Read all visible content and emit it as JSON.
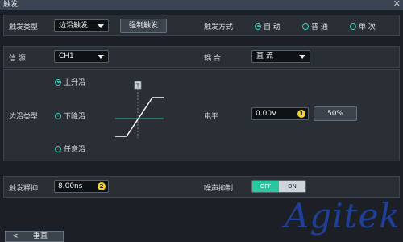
{
  "window": {
    "title": "触发",
    "close_icon": "close-icon"
  },
  "trigger_type": {
    "label": "触发类型",
    "value": "边沿触发",
    "force_button": "强制触发"
  },
  "trigger_mode": {
    "label": "触发方式",
    "options": [
      "自 动",
      "普 通",
      "单 次"
    ],
    "selected_index": 0
  },
  "source": {
    "label": "信 源",
    "value": "CH1"
  },
  "coupling": {
    "label": "耦 合",
    "value": "直 流"
  },
  "edge": {
    "label": "边沿类型",
    "options": [
      "上升沿",
      "下降沿",
      "任意沿"
    ],
    "selected_index": 0,
    "diagram_marker": "T"
  },
  "level": {
    "label": "电平",
    "value": "0.00V",
    "knob": "1",
    "fifty_button": "50%"
  },
  "holdoff": {
    "label": "触发释抑",
    "value": "8.00ns",
    "knob": "2"
  },
  "noise_reject": {
    "label": "噪声抑制",
    "off_label": "OFF",
    "on_label": "ON",
    "state": "off"
  },
  "footer": {
    "back_label": "垂直",
    "back_icon": "chevron-left-icon"
  },
  "watermark": "Agitek",
  "colors": {
    "accent": "#2fd0b8",
    "toggle_active": "#29c7a0",
    "knob": "#f2cf2a",
    "watermark": "#1f3f9a"
  }
}
